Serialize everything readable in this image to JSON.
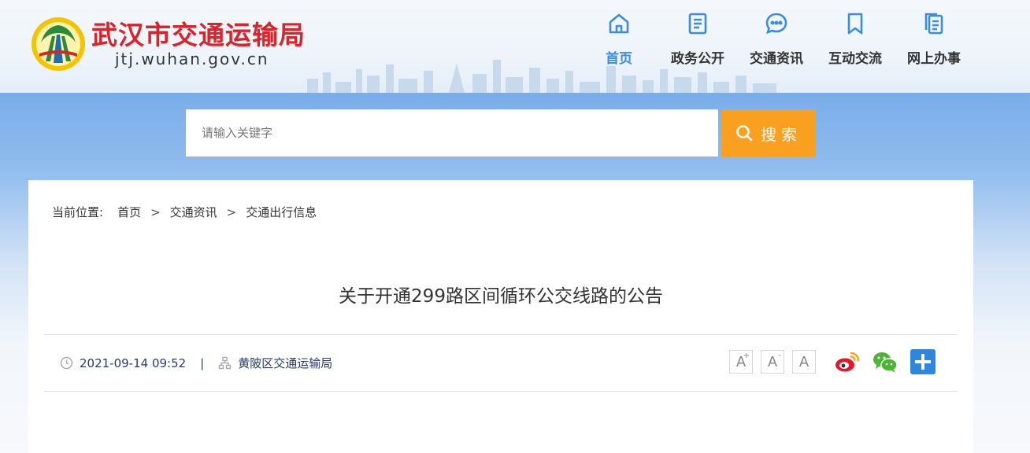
{
  "header": {
    "site_title": "武汉市交通运输局",
    "site_domain": "jtj.wuhan.gov.cn",
    "logo_icon": "wuhan-emblem-icon"
  },
  "nav": {
    "items": [
      {
        "label": "首页",
        "icon": "home-icon",
        "active": true
      },
      {
        "label": "政务公开",
        "icon": "document-icon"
      },
      {
        "label": "交通资讯",
        "icon": "chat-icon"
      },
      {
        "label": "互动交流",
        "icon": "bookmark-icon"
      },
      {
        "label": "网上办事",
        "icon": "files-icon"
      }
    ],
    "active_color": "#3a8de0"
  },
  "search": {
    "placeholder": "请输入关键字",
    "button_label": "搜索",
    "button_color": "#f9a020"
  },
  "breadcrumb": {
    "prefix": "当前位置:",
    "items": [
      "首页",
      "交通资讯",
      "交通出行信息"
    ],
    "separator": ">"
  },
  "article": {
    "title": "关于开通299路区间循环公交线路的公告",
    "date": "2021-09-14 09:52",
    "separator": "|",
    "source": "黄陂区交通运输局"
  },
  "font_tools": {
    "increase": "A",
    "increase_sup": "+",
    "decrease": "A",
    "decrease_sup": "-",
    "reset": "A"
  },
  "share": {
    "items": [
      "weibo-icon",
      "wechat-icon",
      "more-share-icon"
    ]
  }
}
